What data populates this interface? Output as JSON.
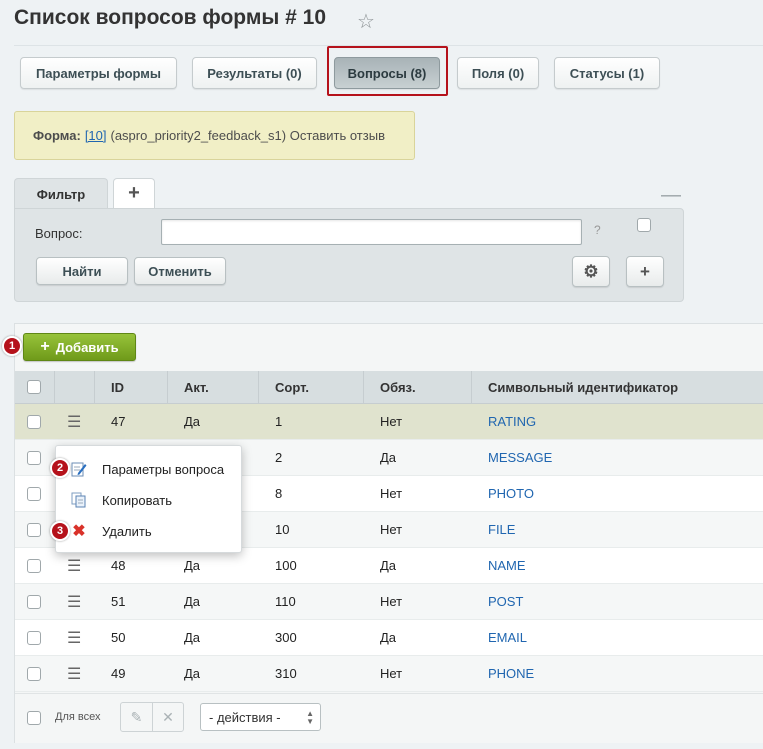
{
  "page": {
    "title": "Список вопросов формы # 10"
  },
  "tabs": [
    {
      "label": "Параметры формы"
    },
    {
      "label": "Результаты (0)"
    },
    {
      "label": "Вопросы (8)",
      "active": true
    },
    {
      "label": "Поля (0)"
    },
    {
      "label": "Статусы (1)"
    }
  ],
  "form_note": {
    "label": "Форма:",
    "link": "[10]",
    "text": "(aspro_priority2_feedback_s1) Оставить отзыв"
  },
  "filter": {
    "tab_label": "Фильтр",
    "add_tab": "+",
    "field_label": "Вопрос:",
    "field_value": "",
    "help": "?",
    "find_button": "Найти",
    "cancel_button": "Отменить"
  },
  "toolbar": {
    "add_button": "Добавить"
  },
  "badges": [
    "1",
    "2",
    "3"
  ],
  "table": {
    "columns": [
      "ID",
      "Акт.",
      "Сорт.",
      "Обяз.",
      "Символьный идентификатор"
    ],
    "rows": [
      {
        "id": "47",
        "active": "Да",
        "sort": "1",
        "required": "Нет",
        "symbol": "RATING"
      },
      {
        "id": "",
        "active": "",
        "sort": "2",
        "required": "Да",
        "symbol": "MESSAGE"
      },
      {
        "id": "",
        "active": "",
        "sort": "8",
        "required": "Нет",
        "symbol": "PHOTO"
      },
      {
        "id": "",
        "active": "",
        "sort": "10",
        "required": "Нет",
        "symbol": "FILE"
      },
      {
        "id": "48",
        "active": "Да",
        "sort": "100",
        "required": "Да",
        "symbol": "NAME"
      },
      {
        "id": "51",
        "active": "Да",
        "sort": "110",
        "required": "Нет",
        "symbol": "POST"
      },
      {
        "id": "50",
        "active": "Да",
        "sort": "300",
        "required": "Да",
        "symbol": "EMAIL"
      },
      {
        "id": "49",
        "active": "Да",
        "sort": "310",
        "required": "Нет",
        "symbol": "PHONE"
      }
    ]
  },
  "context_menu": {
    "items": [
      {
        "label": "Параметры вопроса",
        "icon": "edit-icon"
      },
      {
        "label": "Копировать",
        "icon": "copy-icon"
      },
      {
        "label": "Удалить",
        "icon": "delete-icon"
      }
    ]
  },
  "footer": {
    "for_all_label": "Для всех",
    "actions_select": "- действия -"
  },
  "colors": {
    "accent_red": "#b5121b",
    "add_green": "#7aa623",
    "link_blue": "#2066b0"
  }
}
